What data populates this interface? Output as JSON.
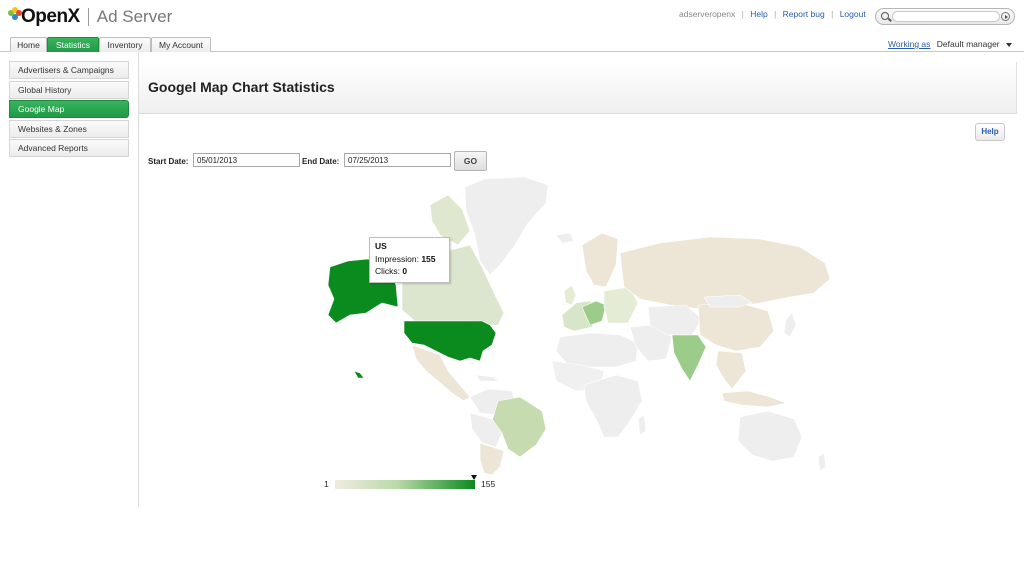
{
  "header": {
    "brand": "OpenX",
    "product": "Ad Server",
    "username": "adserveropenx",
    "links": [
      "Help",
      "Report bug",
      "Logout"
    ],
    "search_placeholder": ""
  },
  "tabs": [
    "Home",
    "Statistics",
    "Inventory",
    "My Account"
  ],
  "active_tab": "Statistics",
  "working_as": {
    "label": "Working as",
    "value": "Default manager"
  },
  "sidebar": {
    "items": [
      "Advertisers & Campaigns",
      "Global History",
      "Google Map",
      "Websites & Zones",
      "Advanced Reports"
    ],
    "active": "Google Map"
  },
  "page": {
    "title": "Googel Map Chart Statistics",
    "help_label": "Help"
  },
  "filters": {
    "start_label": "Start Date:",
    "start_value": "05/01/2013",
    "end_label": "End Date:",
    "end_value": "07/25/2013",
    "go_label": "GO"
  },
  "tooltip": {
    "country": "US",
    "impression_label": "Impression:",
    "impression_value": "155",
    "clicks_label": "Clicks:",
    "clicks_value": "0"
  },
  "legend": {
    "min": "1",
    "max": "155"
  },
  "colors": {
    "accent_green": "#1f9a45",
    "map_max": "#0b8a1e",
    "map_low": "#ede6d6",
    "map_none": "#eeeeee",
    "link": "#2a5db0"
  }
}
